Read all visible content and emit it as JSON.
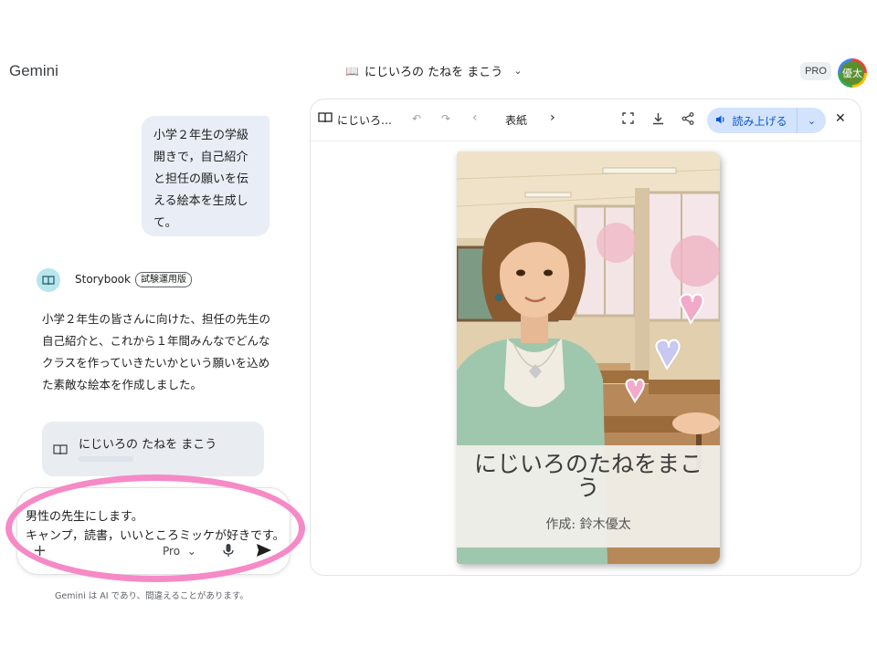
{
  "app": {
    "brand": "Gemini"
  },
  "header": {
    "title_icon": "book-icon",
    "title": "にじいろの たねを まこう",
    "plan_badge": "PRO",
    "avatar_label": "優太"
  },
  "chat": {
    "user_message": "小学２年生の学級開きで，自己紹介と担任の願いを伝える絵本を生成して。",
    "agent": {
      "name": "Storybook",
      "tag": "試験運用版",
      "icon": "storybook-icon"
    },
    "agent_reply": "小学２年生の皆さんに向けた、担任の先生の自己紹介と、これから１年間みんなでどんなクラスを作っていきたいかという願いを込めた素敵な絵本を作成しました。",
    "book_card": {
      "title": "にじいろの たねを まこう",
      "icon": "book-icon"
    }
  },
  "composer": {
    "text_line1": "男性の先生にします。",
    "text_line2": "キャンプ，読書，いいところミッケが好きです。",
    "model": "Pro",
    "icons": [
      "plus-icon",
      "chevron-down-icon",
      "mic-icon",
      "send-icon"
    ]
  },
  "disclaimer": "Gemini は AI であり、間違えることがあります。",
  "panel": {
    "book_title": "にじいろ…",
    "page_label": "表紙",
    "read_aloud": "読み上げる",
    "icons": [
      "book-icon",
      "undo-icon",
      "redo-icon",
      "chevron-left-icon",
      "chevron-right-icon",
      "fullscreen-icon",
      "download-icon",
      "share-icon",
      "speaker-icon",
      "chevron-down-icon",
      "close-icon"
    ],
    "cover": {
      "title": "にじいろのたねをまこう",
      "author": "作成: 鈴木優太"
    }
  },
  "colors": {
    "accent": "#0b57d0",
    "read_bg": "#d3e3fd",
    "user_bubble": "#e9eef6",
    "highlight_ring": "#f58ac7"
  }
}
